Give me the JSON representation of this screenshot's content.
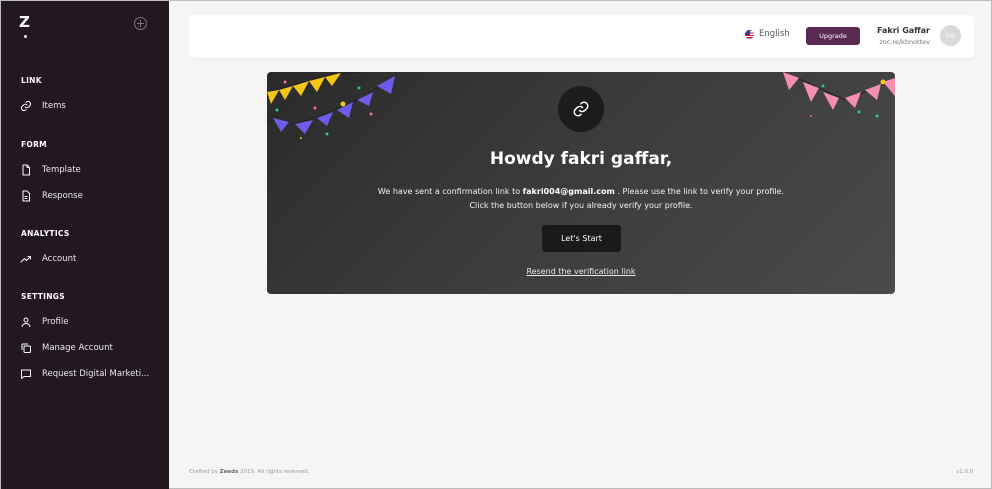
{
  "app": {
    "logo": "Z"
  },
  "sidebar": {
    "sections": [
      {
        "title": "LINK",
        "items": [
          {
            "label": "Items",
            "icon": "link-icon"
          }
        ]
      },
      {
        "title": "FORM",
        "items": [
          {
            "label": "Template",
            "icon": "document-icon"
          },
          {
            "label": "Response",
            "icon": "document-text-icon"
          }
        ]
      },
      {
        "title": "ANALYTICS",
        "items": [
          {
            "label": "Account",
            "icon": "trending-up-icon"
          }
        ]
      },
      {
        "title": "SETTINGS",
        "items": [
          {
            "label": "Profile",
            "icon": "user-icon"
          },
          {
            "label": "Manage Account",
            "icon": "copy-icon"
          },
          {
            "label": "Request Digital Marketi...",
            "icon": "message-icon"
          }
        ]
      }
    ]
  },
  "header": {
    "language": "English",
    "upgrade_label": "Upgrade",
    "user_name": "Fakri Gaffar",
    "user_handle": "zoc.re/kbnottev",
    "avatar_initials": "FG"
  },
  "banner": {
    "greeting": "Howdy fakri gaffar,",
    "message_prefix": "We have sent a confirmation link to ",
    "email": "fakri004@gmail.com",
    "message_suffix": " . Please use the link to verify your profile.",
    "message_line2": "Click the button below if you already verify your profile.",
    "start_label": "Let's Start",
    "resend_label": "Resend the verification link"
  },
  "footer": {
    "crafted_prefix": "Crafted by ",
    "crafted_brand": "Zeeds",
    "crafted_suffix": " 2019. All rights reserved.",
    "version": "v1.0.0"
  },
  "colors": {
    "sidebar_bg": "#231720",
    "accent": "#5a2a52",
    "banner_bg": "#333333"
  }
}
